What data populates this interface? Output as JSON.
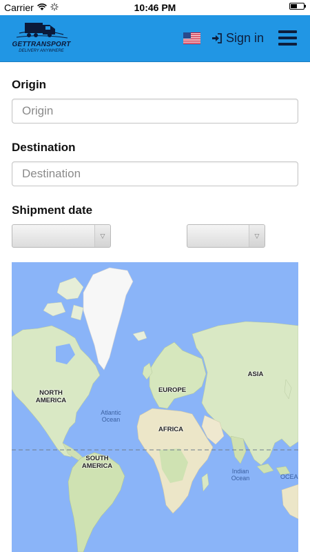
{
  "status_bar": {
    "carrier": "Carrier",
    "time": "10:46 PM"
  },
  "header": {
    "logo_text": "GETTRANSPORT",
    "logo_tagline": "DELIVERY ANYWHERE",
    "sign_in_label": "Sign in",
    "background_color": "#2196e4"
  },
  "form": {
    "origin": {
      "label": "Origin",
      "placeholder": "Origin",
      "value": ""
    },
    "destination": {
      "label": "Destination",
      "placeholder": "Destination",
      "value": ""
    },
    "shipment_date": {
      "label": "Shipment date",
      "first_select_value": "",
      "second_select_value": ""
    }
  },
  "map": {
    "continent_labels": [
      "NORTH AMERICA",
      "EUROPE",
      "ASIA",
      "AFRICA",
      "SOUTH AMERICA"
    ],
    "ocean_labels": [
      "Atlantic Ocean",
      "Indian Ocean",
      "OCEA"
    ],
    "water_color": "#8ab4f8",
    "land_color": "#d9e8c4"
  }
}
